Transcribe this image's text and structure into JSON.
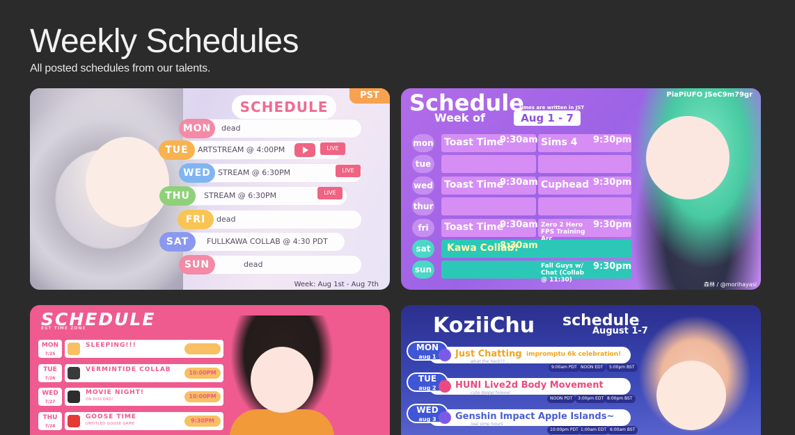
{
  "page": {
    "title": "Weekly Schedules",
    "subtitle": "All posted schedules from our talents."
  },
  "cards": [
    {
      "title": "SCHEDULE",
      "badge": "PST",
      "rows": [
        {
          "day": "MON",
          "event": "dead",
          "color": "#f48aa6"
        },
        {
          "day": "TUE",
          "event": "ARTSTREAM @ 4:00PM",
          "live": "LIVE",
          "color": "#f8b24e"
        },
        {
          "day": "WED",
          "event": "STREAM @ 6:30PM",
          "live": "LIVE",
          "color": "#7fb6f2"
        },
        {
          "day": "THU",
          "event": "STREAM @ 6:30PM",
          "live": "LIVE",
          "color": "#8fd17a"
        },
        {
          "day": "FRI",
          "event": "dead",
          "color": "#f8c453"
        },
        {
          "day": "SAT",
          "event": "FULLKAWA COLLAB @ 4:30 PDT",
          "color": "#8a98f0"
        },
        {
          "day": "SUN",
          "event": "dead",
          "color": "#f48aa6"
        }
      ],
      "week": "Week: Aug 1st - Aug 7th"
    },
    {
      "title": "Schedule",
      "note": "times are written in JST",
      "week_label": "Week of",
      "week_range": "Aug 1 - 7",
      "social": "PiaPiUFO  JSeC9m79gr",
      "rows": [
        {
          "day": "mon",
          "event": "Toast Time",
          "time": "9:30am",
          "event2": "Sims 4",
          "time2": "9:30pm"
        },
        {
          "day": "tue",
          "event": "",
          "time": "",
          "event2": "",
          "time2": ""
        },
        {
          "day": "wed",
          "event": "Toast Time",
          "time": "9:30am",
          "event2": "Cuphead",
          "time2": "9:30pm"
        },
        {
          "day": "thur",
          "event": "",
          "time": "",
          "event2": "",
          "time2": ""
        },
        {
          "day": "fri",
          "event": "Toast Time",
          "time": "9:30am",
          "event2": "Zero 2 Hero FPS Training Arc",
          "time2": "9:30pm"
        },
        {
          "day": "sat",
          "event": "Kawa Collab!",
          "time": "8:30am",
          "event2": "",
          "time2": ""
        },
        {
          "day": "sun",
          "event": "",
          "time": "",
          "event2": "Fall Guys w/ Chat (Collab @ 11:30)",
          "time2": "9:30pm"
        }
      ],
      "credit": "森林 / @morihayasi"
    },
    {
      "title": "SCHEDULE",
      "timezone": "EST TIME ZONE",
      "rows": [
        {
          "day": "MON",
          "date": "7/25",
          "event": "SLEEPING!!!",
          "sub": "",
          "time": "",
          "icon_color": "#f8c063"
        },
        {
          "day": "TUE",
          "date": "7/26",
          "event": "VERMINTIDE COLLAB",
          "sub": "",
          "time": "10:00PM",
          "icon_color": "#3a3a3a"
        },
        {
          "day": "WED",
          "date": "7/27",
          "event": "MOVIE NIGHT!",
          "sub": "ON DISCORD!",
          "time": "10:00PM",
          "icon_color": "#5865f2"
        },
        {
          "day": "THU",
          "date": "7/28",
          "event": "GOOSE TIME",
          "sub": "UNTITLED GOOSE GAME",
          "time": "9:30PM",
          "icon_color": "#e53935"
        }
      ]
    },
    {
      "brand": "KoziiChu",
      "title": "schedule",
      "date": "August 1-7",
      "rows": [
        {
          "day": "MON",
          "date": "aug 1",
          "event": "Just Chatting",
          "event_extra": "impromptu 6k celebration!",
          "sub": "what the heck??",
          "times": [
            "9:00am PDT",
            "NOON EDT",
            "5:00pm BST"
          ],
          "event_color": "#f3a41b",
          "icon_color": "#7b5be6"
        },
        {
          "day": "TUE",
          "date": "aug 2",
          "event": "HUNI Live2d Body Movement",
          "event_extra": "",
          "sub": "cute doggo forever",
          "times": [
            "NOON PDT",
            "3:00pm EDT",
            "8:00pm BST"
          ],
          "event_color": "#e94b7f",
          "icon_color": "#e94b7f"
        },
        {
          "day": "WED",
          "date": "aug 3",
          "event": "Genshin Impact Apple Islands~",
          "event_extra": "",
          "sub": "real simp hours",
          "times": [
            "10:00pm PDT",
            "1:00am EDT",
            "6:00am BST"
          ],
          "event_color": "#4b5fd6",
          "icon_color": "#7b5be6"
        }
      ]
    }
  ]
}
